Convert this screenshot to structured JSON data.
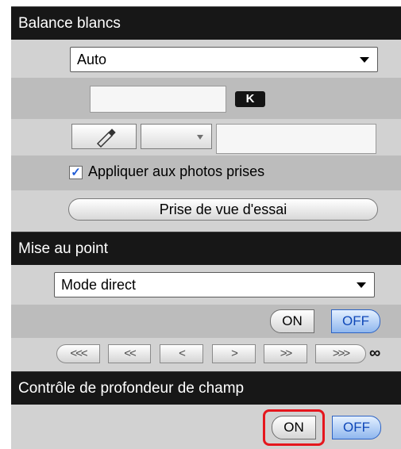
{
  "white_balance": {
    "header": "Balance blancs",
    "mode_value": "Auto",
    "kelvin_badge": "K",
    "apply_checkbox": {
      "checked": true,
      "mark": "✓",
      "label": "Appliquer aux photos prises"
    },
    "test_shot_button": "Prise de vue d'essai"
  },
  "focus": {
    "header": "Mise au point",
    "mode_value": "Mode direct",
    "toggle_on": "ON",
    "toggle_off": "OFF",
    "toggle_state": "OFF",
    "steps": [
      "<<<",
      "<<",
      "<",
      ">",
      ">>",
      ">>>"
    ],
    "infinity": "∞"
  },
  "depth_of_field": {
    "header": "Contrôle de profondeur de champ",
    "toggle_on": "ON",
    "toggle_off": "OFF",
    "toggle_state": "OFF",
    "callout_target": "ON"
  },
  "colors": {
    "header_bg": "#171717",
    "active_blue": "#2d63c4",
    "callout_red": "#e5161d",
    "check_blue": "#1f5bd6"
  }
}
